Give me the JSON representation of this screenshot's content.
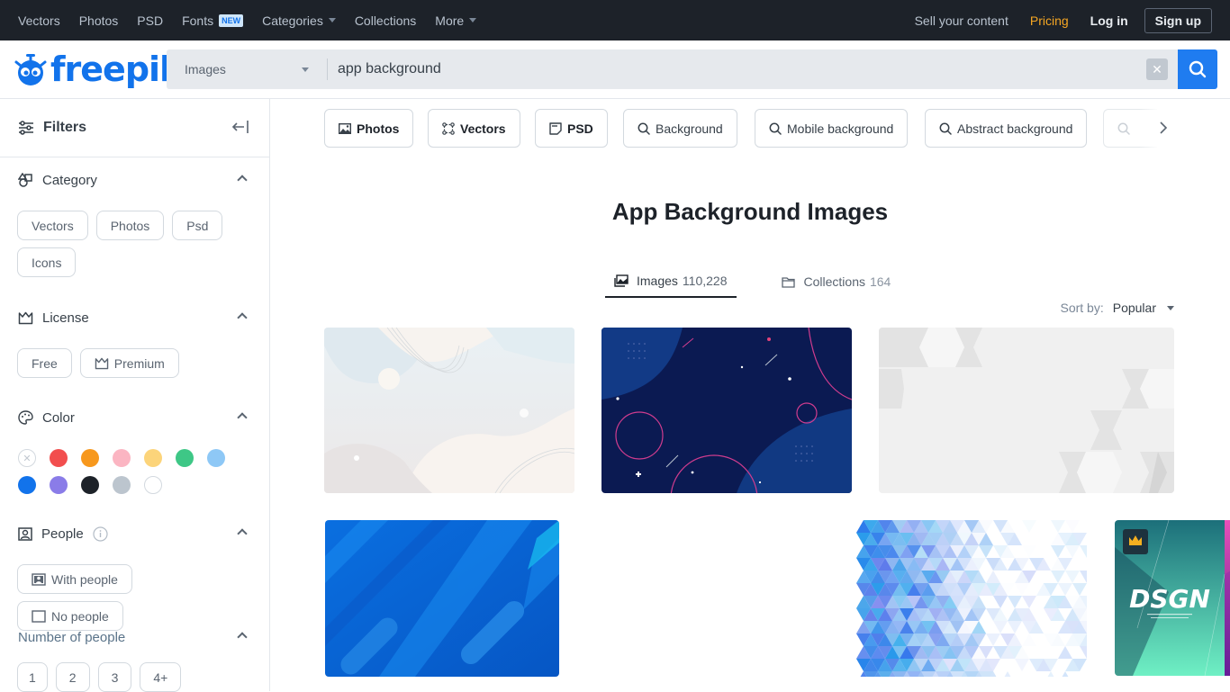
{
  "topnav": {
    "items": [
      {
        "label": "Vectors"
      },
      {
        "label": "Photos"
      },
      {
        "label": "PSD"
      },
      {
        "label": "Fonts",
        "badge": "NEW"
      },
      {
        "label": "Categories",
        "dropdown": true
      },
      {
        "label": "Collections"
      },
      {
        "label": "More",
        "dropdown": true
      }
    ],
    "right": {
      "sell": "Sell your content",
      "pricing": "Pricing",
      "login": "Log in",
      "signup": "Sign up"
    }
  },
  "header": {
    "logo_text": "freepik",
    "search": {
      "type_selected": "Images",
      "query": "app background",
      "clear_icon": "close-icon",
      "search_icon": "search-icon"
    }
  },
  "sidebar": {
    "title": "Filters",
    "sections": {
      "category": {
        "title": "Category",
        "options": [
          "Vectors",
          "Photos",
          "Psd",
          "Icons"
        ]
      },
      "license": {
        "title": "License",
        "options": [
          "Free",
          "Premium"
        ]
      },
      "color": {
        "title": "Color",
        "swatches": [
          "none",
          "#f24e4e",
          "#f7981d",
          "#fbb5c2",
          "#fcd47a",
          "#3ec786",
          "#8ec8f6",
          "#1273eb",
          "#8a7ce8",
          "#1d2229",
          "#bcc5ce",
          "#ffffff"
        ]
      },
      "people": {
        "title": "People",
        "options": [
          "With people",
          "No people"
        ]
      },
      "number_of_people": {
        "title": "Number of people",
        "options": [
          "1",
          "2",
          "3",
          "4+"
        ]
      }
    }
  },
  "main": {
    "related": [
      {
        "label": "Photos",
        "icon": "image-icon",
        "bold": true
      },
      {
        "label": "Vectors",
        "icon": "vector-icon",
        "bold": true
      },
      {
        "label": "PSD",
        "icon": "psd-icon",
        "bold": true
      },
      {
        "label": "Background",
        "icon": "search-icon"
      },
      {
        "label": "Mobile background",
        "icon": "search-icon"
      },
      {
        "label": "Abstract background",
        "icon": "search-icon"
      }
    ],
    "title": "App Background Images",
    "tabs": [
      {
        "label": "Images",
        "count": "110,228",
        "active": true
      },
      {
        "label": "Collections",
        "count": "164",
        "active": false
      }
    ],
    "sort": {
      "label": "Sort by:",
      "value": "Popular"
    },
    "results": [
      {
        "name": "light-pastel-wave-background"
      },
      {
        "name": "dark-blue-geometric-background"
      },
      {
        "name": "gray-hexagon-background"
      },
      {
        "name": "blue-diagonal-stripes-background"
      },
      {
        "name": "blue-triangle-mosaic-background"
      },
      {
        "name": "dsgn-gradient-posters",
        "premium": true,
        "poster_text": "DSGN"
      }
    ]
  }
}
